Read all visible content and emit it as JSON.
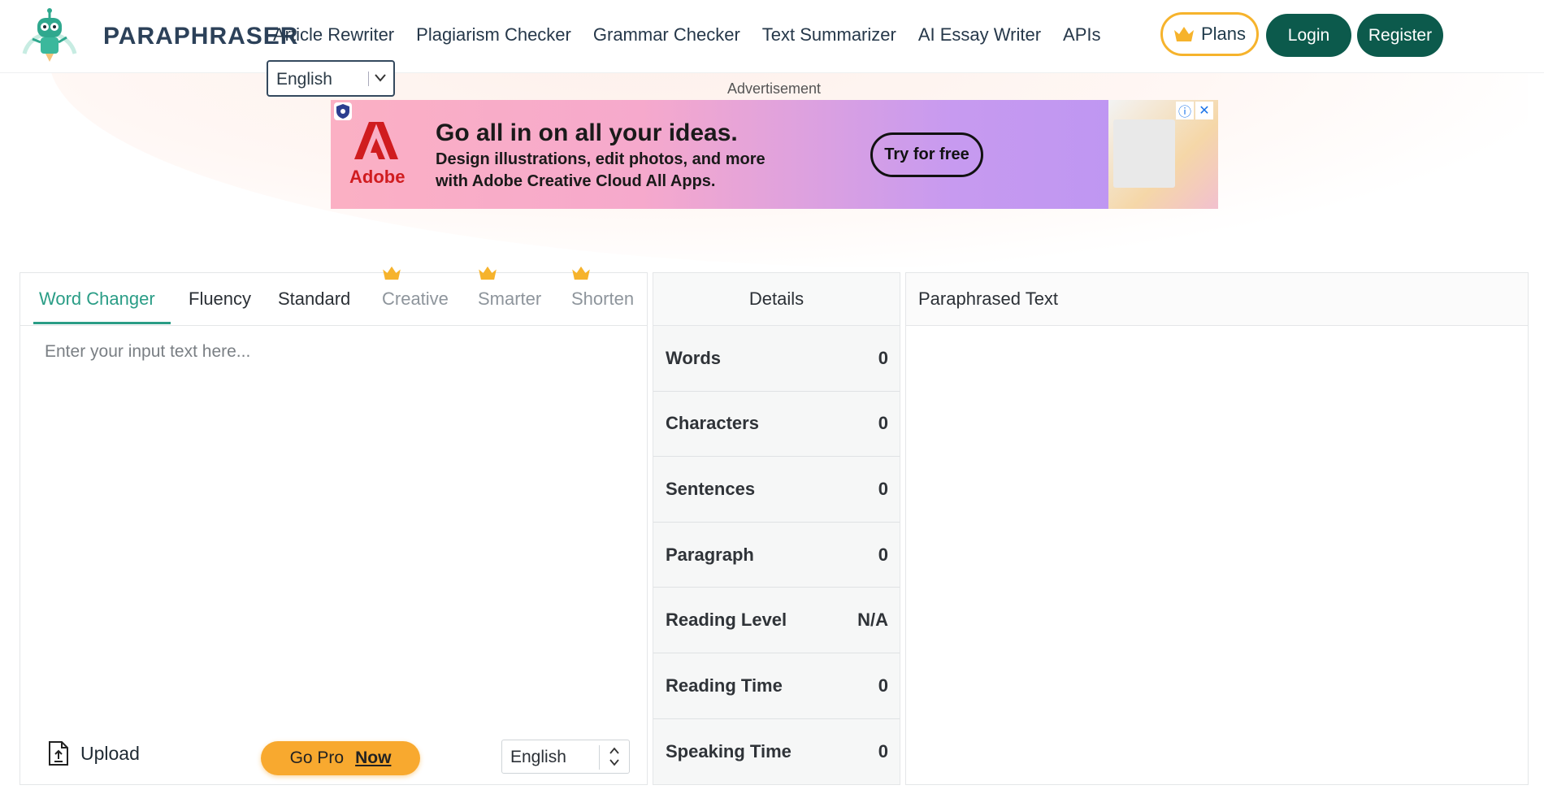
{
  "header": {
    "brand": "PARAPHRASER",
    "nav": [
      "Article Rewriter",
      "Plagiarism Checker",
      "Grammar Checker",
      "Text Summarizer",
      "AI Essay Writer",
      "APIs"
    ],
    "plans_label": "Plans",
    "login_label": "Login",
    "register_label": "Register",
    "language": "English"
  },
  "ad": {
    "label": "Advertisement",
    "brand": "Adobe",
    "headline": "Go all in on all your ideas.",
    "subtext": "Design illustrations, edit photos, and more with Adobe Creative Cloud All Apps.",
    "cta": "Try for free",
    "info_icon": "ⓘ",
    "close_icon": "✕"
  },
  "modes": {
    "tabs": [
      {
        "label": "Word Changer",
        "active": true,
        "locked": false
      },
      {
        "label": "Fluency",
        "active": false,
        "locked": false
      },
      {
        "label": "Standard",
        "active": false,
        "locked": false
      },
      {
        "label": "Creative",
        "active": false,
        "locked": true
      },
      {
        "label": "Smarter",
        "active": false,
        "locked": true
      },
      {
        "label": "Shorten",
        "active": false,
        "locked": true
      }
    ]
  },
  "input": {
    "placeholder": "Enter your input text here...",
    "upload_label": "Upload",
    "gopro_label": "Go Pro",
    "gopro_emphasis": "Now",
    "language": "English"
  },
  "details": {
    "title": "Details",
    "stats": [
      {
        "label": "Words",
        "value": "0"
      },
      {
        "label": "Characters",
        "value": "0"
      },
      {
        "label": "Sentences",
        "value": "0"
      },
      {
        "label": "Paragraph",
        "value": "0"
      },
      {
        "label": "Reading Level",
        "value": "N/A"
      },
      {
        "label": "Reading Time",
        "value": "0"
      },
      {
        "label": "Speaking Time",
        "value": "0"
      }
    ]
  },
  "output": {
    "title": "Paraphrased Text"
  },
  "colors": {
    "accent": "#2a9d86",
    "primary_button": "#0c5a4c",
    "pro": "#f8a92f",
    "brand_text": "#2c4159"
  }
}
